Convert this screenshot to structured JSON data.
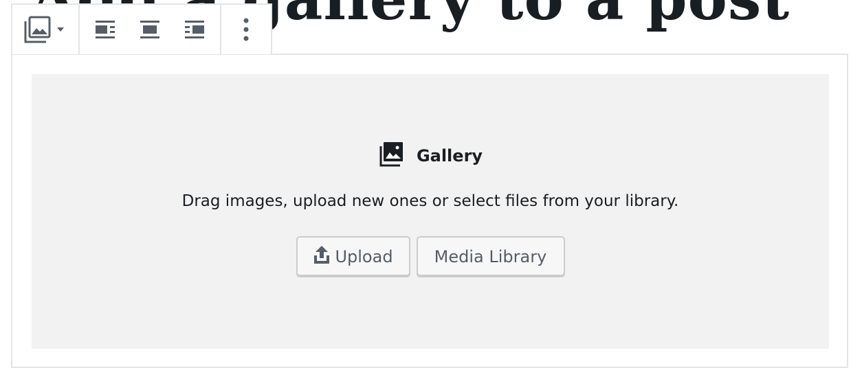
{
  "post": {
    "title": "Add a gallery to a post"
  },
  "toolbar": {
    "block_switcher_icon": "gallery-icon",
    "dropdown_icon": "caret-down-icon",
    "align_buttons": [
      {
        "name": "align-left-button",
        "icon": "align-left-icon"
      },
      {
        "name": "align-center-button",
        "icon": "align-center-icon"
      },
      {
        "name": "align-right-button",
        "icon": "align-right-icon"
      }
    ],
    "more_icon": "more-vertical-icon"
  },
  "placeholder": {
    "label": "Gallery",
    "instructions": "Drag images, upload new ones or select files from your library.",
    "upload_label": "Upload",
    "media_library_label": "Media Library"
  },
  "colors": {
    "text": "#191e23",
    "icon": "#555d66",
    "border": "#e2e4e7",
    "placeholder_bg": "#f2f2f2",
    "button_bg": "#f7f7f7",
    "button_border": "#cccccc"
  }
}
